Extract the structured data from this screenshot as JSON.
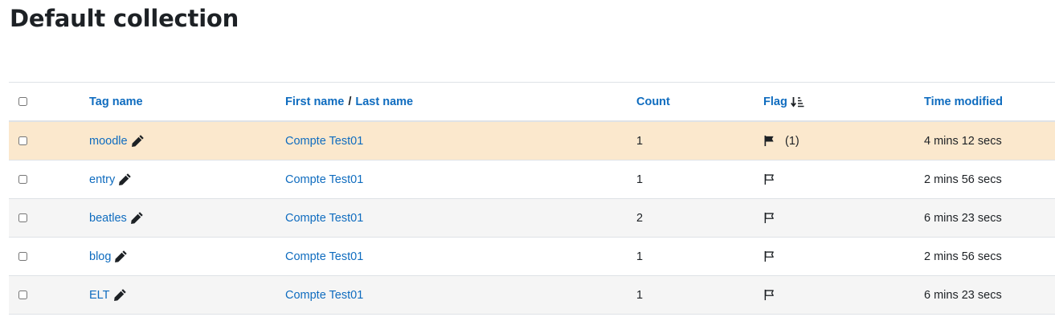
{
  "page": {
    "title": "Default collection"
  },
  "table": {
    "headers": {
      "tag_name": "Tag name",
      "first_name": "First name",
      "name_separator": "/",
      "last_name": "Last name",
      "count": "Count",
      "flag": "Flag",
      "time_modified": "Time modified"
    },
    "sort": {
      "column": "flag",
      "icon": "sort-amount-down-icon"
    },
    "rows": [
      {
        "tag": "moodle",
        "name": "Compte Test01",
        "count": "1",
        "flagged": true,
        "flag_count": "(1)",
        "time": "4 mins 12 secs",
        "highlight": true
      },
      {
        "tag": "entry",
        "name": "Compte Test01",
        "count": "1",
        "flagged": false,
        "flag_count": "",
        "time": "2 mins 56 secs",
        "highlight": false
      },
      {
        "tag": "beatles",
        "name": "Compte Test01",
        "count": "2",
        "flagged": false,
        "flag_count": "",
        "time": "6 mins 23 secs",
        "highlight": false
      },
      {
        "tag": "blog",
        "name": "Compte Test01",
        "count": "1",
        "flagged": false,
        "flag_count": "",
        "time": "2 mins 56 secs",
        "highlight": false
      },
      {
        "tag": "ELT",
        "name": "Compte Test01",
        "count": "1",
        "flagged": false,
        "flag_count": "",
        "time": "6 mins 23 secs",
        "highlight": false
      }
    ]
  },
  "colors": {
    "link": "#0f6cbf",
    "highlight_row": "#fbe8cd",
    "striped_row": "#f5f5f5",
    "text": "#1d2125"
  },
  "icons": {
    "edit": "pencil-icon",
    "flagged": "flag-filled-icon",
    "unflagged": "flag-outline-icon"
  }
}
